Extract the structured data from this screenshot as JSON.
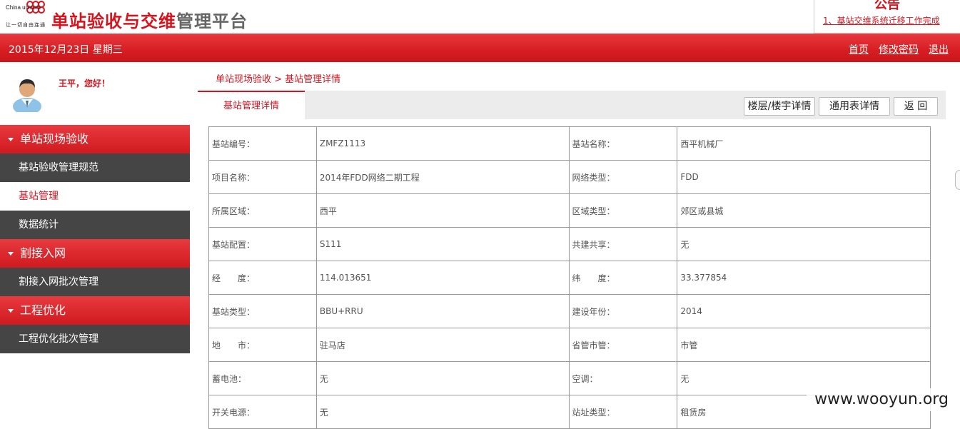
{
  "header": {
    "logo_en": "China unicom",
    "logo_cn": "中国联通",
    "logo_tagline": "让一切自由连通",
    "brand_red": "单站验收与交维",
    "brand_grey": "管理平台"
  },
  "notice": {
    "title": "公告",
    "item": "1、基站交维系统迁移工作完成"
  },
  "topbar": {
    "date": "2015年12月23日 星期三",
    "links": [
      "首页",
      "修改密码",
      "退出"
    ]
  },
  "user": {
    "greeting": "王平，您好！"
  },
  "sidebar": {
    "sections": [
      {
        "label": "单站现场验收",
        "items": [
          "基站验收管理规范",
          "基站管理",
          "数据统计"
        ]
      },
      {
        "label": "割接入网",
        "items": [
          "割接入网批次管理"
        ]
      },
      {
        "label": "工程优化",
        "items": [
          "工程优化批次管理"
        ]
      }
    ]
  },
  "breadcrumb": "单站现场验收 > 基站管理详情",
  "tab": "基站管理详情",
  "buttons": [
    "楼层/楼宇详情",
    "通用表详情",
    "返 回"
  ],
  "rows": [
    [
      "基站编号：",
      "ZMFZ1113",
      "基站名称：",
      "西平机械厂"
    ],
    [
      "项目名称：",
      "2014年FDD网络二期工程",
      "网络类型：",
      "FDD"
    ],
    [
      "所属区域：",
      "西平",
      "区域类型：",
      "郊区或县城"
    ],
    [
      "基站配置：",
      "S111",
      "共建共享：",
      "无"
    ],
    [
      "经　　度：",
      "114.013651",
      "纬　　度：",
      "33.377854"
    ],
    [
      "基站类型：",
      "BBU+RRU",
      "建设年份：",
      "2014"
    ],
    [
      "地　　市：",
      "驻马店",
      "省管市管：",
      "市管"
    ],
    [
      "蓄电池：",
      "无",
      "空调：",
      "无"
    ],
    [
      "开关电源：",
      "无",
      "站址类型：",
      "租赁房"
    ]
  ],
  "watermark": "www.wooyun.org",
  "colors": {
    "accent": "#d7141e",
    "sidebar_dark": "#454545"
  }
}
